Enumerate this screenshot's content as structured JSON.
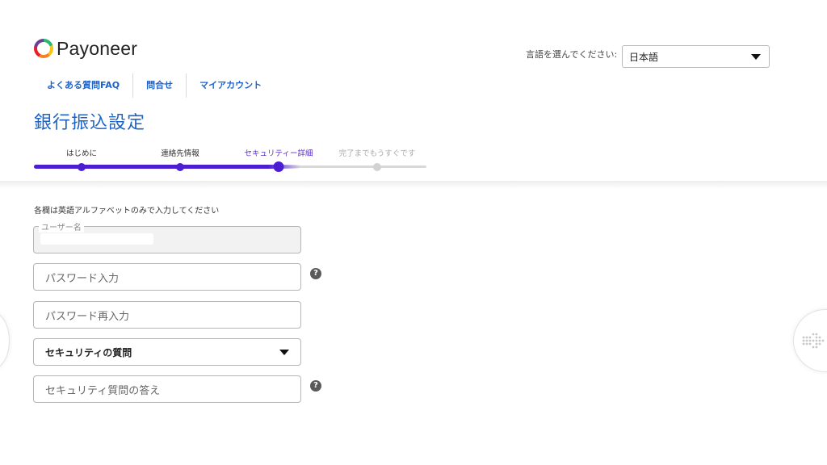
{
  "brand": {
    "name": "Payoneer"
  },
  "language": {
    "label": "言語を選んでください:",
    "selected": "日本語"
  },
  "nav": {
    "items": [
      "よくある質問FAQ",
      "問合せ",
      "マイアカウント"
    ]
  },
  "page": {
    "title": "銀行振込設定"
  },
  "stepper": {
    "steps": [
      "はじめに",
      "連絡先情報",
      "セキュリティー詳細",
      "完了までもうすぐです"
    ],
    "current_step": 3,
    "colors": {
      "active": "#4b1fd1",
      "pending": "#d2d2d2"
    }
  },
  "form": {
    "note": "各欄は英語アルファベットのみで入力してください",
    "username": {
      "label": "ユーザー名",
      "value": ""
    },
    "password": {
      "placeholder": "パスワード入力"
    },
    "password_confirm": {
      "placeholder": "パスワード再入力"
    },
    "security_question": {
      "selected": "セキュリティの質問"
    },
    "security_answer": {
      "placeholder": "セキュリティ質問の答え"
    },
    "help_symbol": "?"
  },
  "colors": {
    "accent": "#1f63c7",
    "progress": "#4b1fd1"
  }
}
